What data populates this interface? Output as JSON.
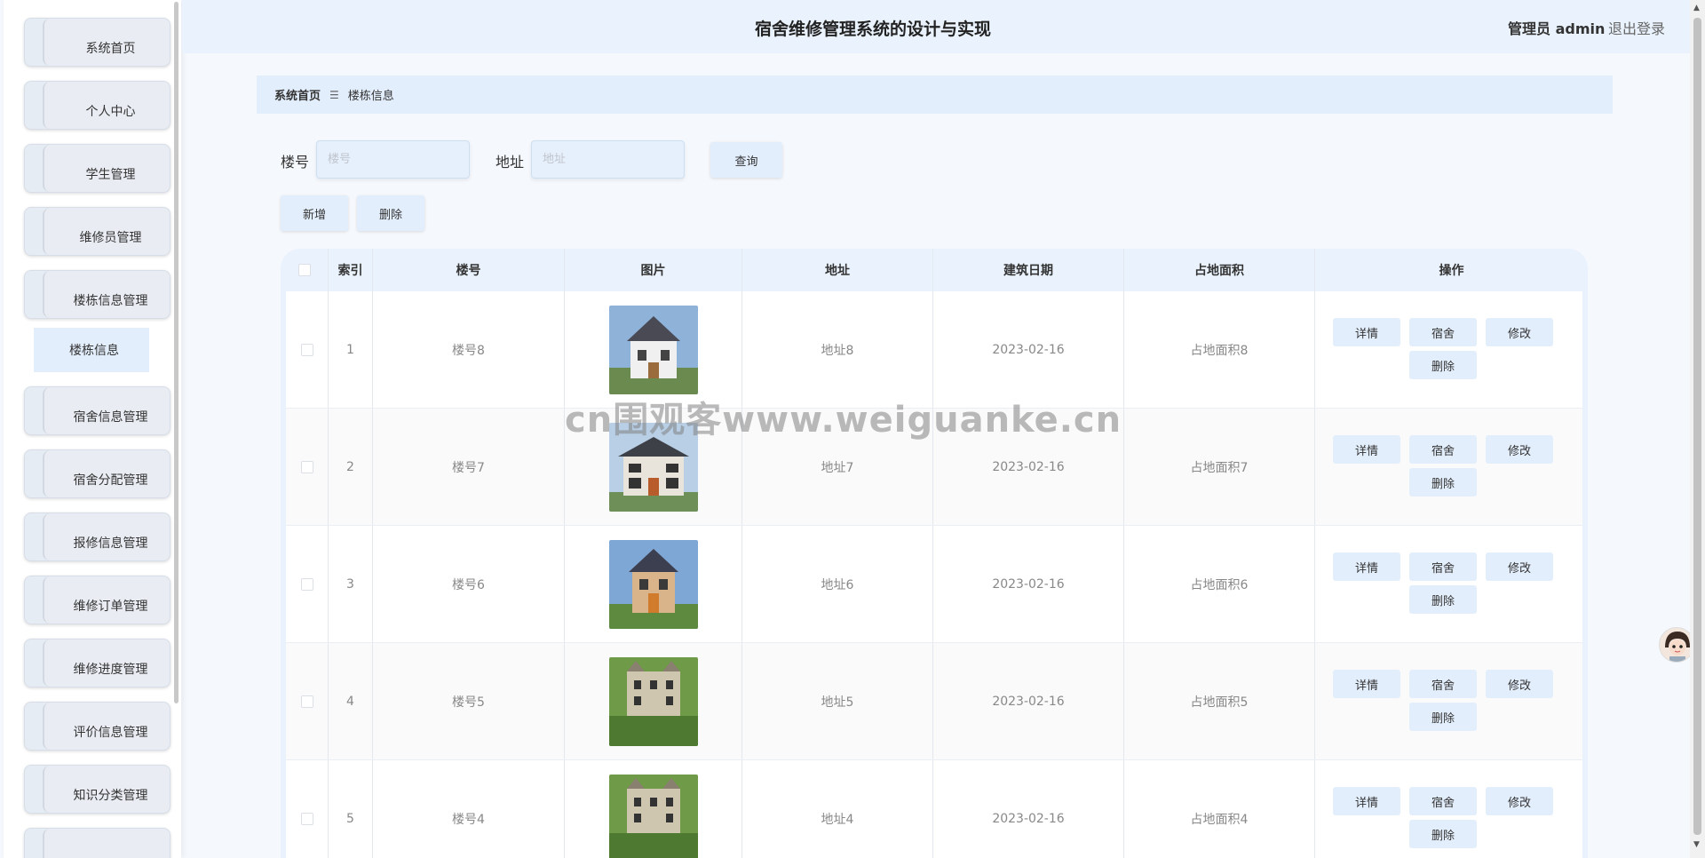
{
  "sidebar": {
    "items": [
      {
        "label": "系统首页"
      },
      {
        "label": "个人中心"
      },
      {
        "label": "学生管理"
      },
      {
        "label": "维修员管理"
      },
      {
        "label": "楼栋信息管理"
      },
      {
        "label": "宿舍信息管理"
      },
      {
        "label": "宿舍分配管理"
      },
      {
        "label": "报修信息管理"
      },
      {
        "label": "维修订单管理"
      },
      {
        "label": "维修进度管理"
      },
      {
        "label": "评价信息管理"
      },
      {
        "label": "知识分类管理"
      }
    ],
    "submenu": {
      "label": "楼栋信息"
    }
  },
  "header": {
    "title": "宿舍维修管理系统的设计与实现",
    "user": "管理员 admin",
    "logout": "退出登录"
  },
  "breadcrumb": {
    "home": "系统首页",
    "sep": "☰",
    "current": "楼栋信息"
  },
  "search": {
    "building_label": "楼号",
    "building_placeholder": "楼号",
    "address_label": "地址",
    "address_placeholder": "地址",
    "query_label": "查询"
  },
  "actions": {
    "add_label": "新增",
    "delete_label": "删除"
  },
  "table": {
    "headers": [
      "索引",
      "楼号",
      "图片",
      "地址",
      "建筑日期",
      "占地面积",
      "操作"
    ],
    "rows": [
      {
        "index": "1",
        "building": "楼号8",
        "address": "地址8",
        "date": "2023-02-16",
        "area": "占地面积8"
      },
      {
        "index": "2",
        "building": "楼号7",
        "address": "地址7",
        "date": "2023-02-16",
        "area": "占地面积7"
      },
      {
        "index": "3",
        "building": "楼号6",
        "address": "地址6",
        "date": "2023-02-16",
        "area": "占地面积6"
      },
      {
        "index": "4",
        "building": "楼号5",
        "address": "地址5",
        "date": "2023-02-16",
        "area": "占地面积5"
      },
      {
        "index": "5",
        "building": "楼号4",
        "address": "地址4",
        "date": "2023-02-16",
        "area": "占地面积4"
      }
    ],
    "ops": {
      "detail": "详情",
      "dorm": "宿舍",
      "edit": "修改",
      "delete": "删除"
    }
  },
  "watermark": "cn围观客www.weiguanke.cn"
}
